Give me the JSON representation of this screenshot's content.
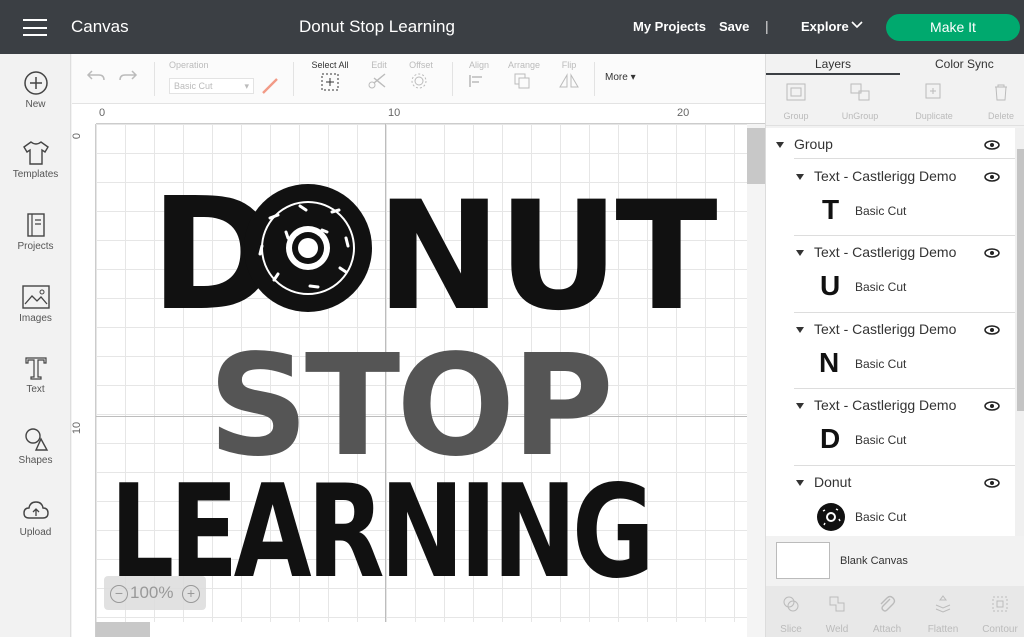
{
  "header": {
    "app_name": "Canvas",
    "project_title": "Donut Stop Learning",
    "my_projects": "My Projects",
    "save": "Save",
    "separator": "|",
    "explore": "Explore",
    "make_it": "Make It"
  },
  "sidebar": {
    "items": [
      {
        "label": "New",
        "icon": "plus-circle-icon"
      },
      {
        "label": "Templates",
        "icon": "shirt-icon"
      },
      {
        "label": "Projects",
        "icon": "book-icon"
      },
      {
        "label": "Images",
        "icon": "image-icon"
      },
      {
        "label": "Text",
        "icon": "text-icon"
      },
      {
        "label": "Shapes",
        "icon": "shapes-icon"
      },
      {
        "label": "Upload",
        "icon": "cloud-upload-icon"
      }
    ]
  },
  "toolbar": {
    "operation_label": "Operation",
    "operation_value": "Basic Cut",
    "select_all": "Select All",
    "edit": "Edit",
    "offset": "Offset",
    "align": "Align",
    "arrange": "Arrange",
    "flip": "Flip",
    "more": "More"
  },
  "canvas": {
    "ruler_top": [
      "0",
      "10",
      "20"
    ],
    "ruler_left": [
      "0",
      "10"
    ],
    "zoom": "100%",
    "zoom_minus": "−",
    "zoom_plus": "+",
    "design_lines": [
      "D",
      "NUT",
      "STOP",
      "LEARNING"
    ]
  },
  "panel": {
    "tabs": [
      "Layers",
      "Color Sync"
    ],
    "tools": [
      "Group",
      "UnGroup",
      "Duplicate",
      "Delete"
    ],
    "layers": {
      "group": "Group",
      "items": [
        {
          "name": "Text - Castlerigg Demo",
          "glyph": "T",
          "cut": "Basic Cut"
        },
        {
          "name": "Text - Castlerigg Demo",
          "glyph": "U",
          "cut": "Basic Cut"
        },
        {
          "name": "Text - Castlerigg Demo",
          "glyph": "N",
          "cut": "Basic Cut"
        },
        {
          "name": "Text - Castlerigg Demo",
          "glyph": "D",
          "cut": "Basic Cut"
        },
        {
          "name": "Donut",
          "glyph": "",
          "cut": "Basic Cut"
        }
      ]
    },
    "blank_canvas": "Blank Canvas",
    "bottom_tools": [
      "Slice",
      "Weld",
      "Attach",
      "Flatten",
      "Contour"
    ]
  },
  "colors": {
    "header_bg": "#3b3f44",
    "make_it_green": "#00a96e",
    "design_black": "#111111",
    "design_gray": "#555555"
  }
}
